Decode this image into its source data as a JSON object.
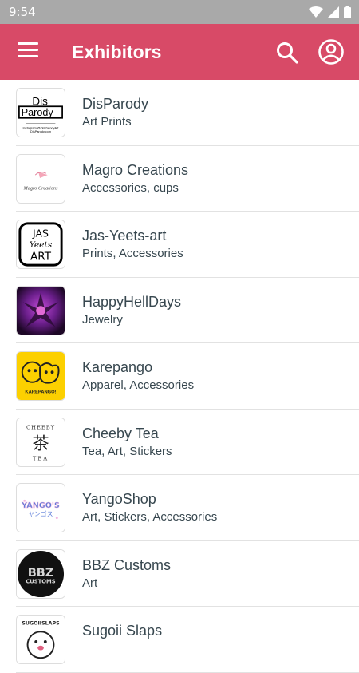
{
  "status_bar": {
    "time": "9:54"
  },
  "app_bar": {
    "title": "Exhibitors"
  },
  "colors": {
    "app_bar": "#d84a67",
    "status_bar": "#a9a9a9",
    "text": "#37474f"
  },
  "exhibitors": [
    {
      "name": "DisParody",
      "categories": "Art Prints"
    },
    {
      "name": "Magro Creations",
      "categories": "Accessories, cups"
    },
    {
      "name": "Jas-Yeets-art",
      "categories": "Prints, Accessories"
    },
    {
      "name": "HappyHellDays",
      "categories": "Jewelry"
    },
    {
      "name": "Karepango",
      "categories": "Apparel, Accessories"
    },
    {
      "name": "Cheeby Tea",
      "categories": "Tea, Art, Stickers"
    },
    {
      "name": "YangoShop",
      "categories": "Art, Stickers, Accessories"
    },
    {
      "name": "BBZ Customs",
      "categories": "Art"
    },
    {
      "name": "Sugoii Slaps",
      "categories": ""
    }
  ],
  "logos": {
    "disparody": {
      "top": "Dis",
      "bottom": "Parody",
      "line1": "Instagram @DisParodyArt",
      "line2": "DisParody.com"
    },
    "magro": "Magro Creations",
    "jas": {
      "l1": "JAS",
      "l2": "Yeets",
      "l3": "ART"
    },
    "karepango": "KAREPANGO!",
    "cheeby": {
      "top": "CHEEBY",
      "glyph": "茶",
      "bottom": "TEA"
    },
    "yango": {
      "top": "YANGO'S",
      "bottom": "ヤンゴス"
    },
    "bbz": {
      "top": "BBZ",
      "bottom": "CUSTOMS"
    },
    "sugoii": "SUGOIISLAPS"
  }
}
